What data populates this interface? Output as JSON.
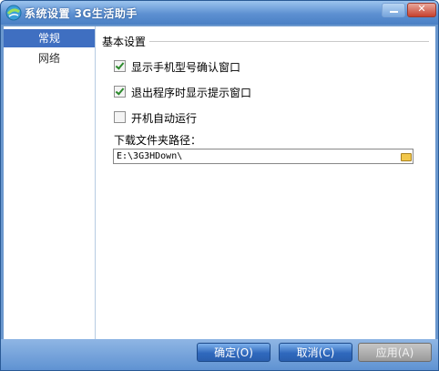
{
  "window": {
    "title": "系统设置 3G生活助手",
    "close_glyph": "✕"
  },
  "sidebar": {
    "items": [
      {
        "label": "常规"
      },
      {
        "label": "网络"
      }
    ]
  },
  "general": {
    "section_title": "基本设置",
    "options": [
      {
        "label": "显示手机型号确认窗口",
        "checked": true
      },
      {
        "label": "退出程序时显示提示窗口",
        "checked": true
      },
      {
        "label": "开机自动运行",
        "checked": false
      }
    ],
    "download_label": "下载文件夹路径：",
    "download_path": "E:\\3G3HDown\\"
  },
  "footer": {
    "ok": "确定(O)",
    "cancel": "取消(C)",
    "apply": "应用(A)"
  },
  "colors": {
    "title_bar": "#5d90d1",
    "selected_item": "#3f6fc1",
    "checkmark": "#2c8a2c"
  }
}
